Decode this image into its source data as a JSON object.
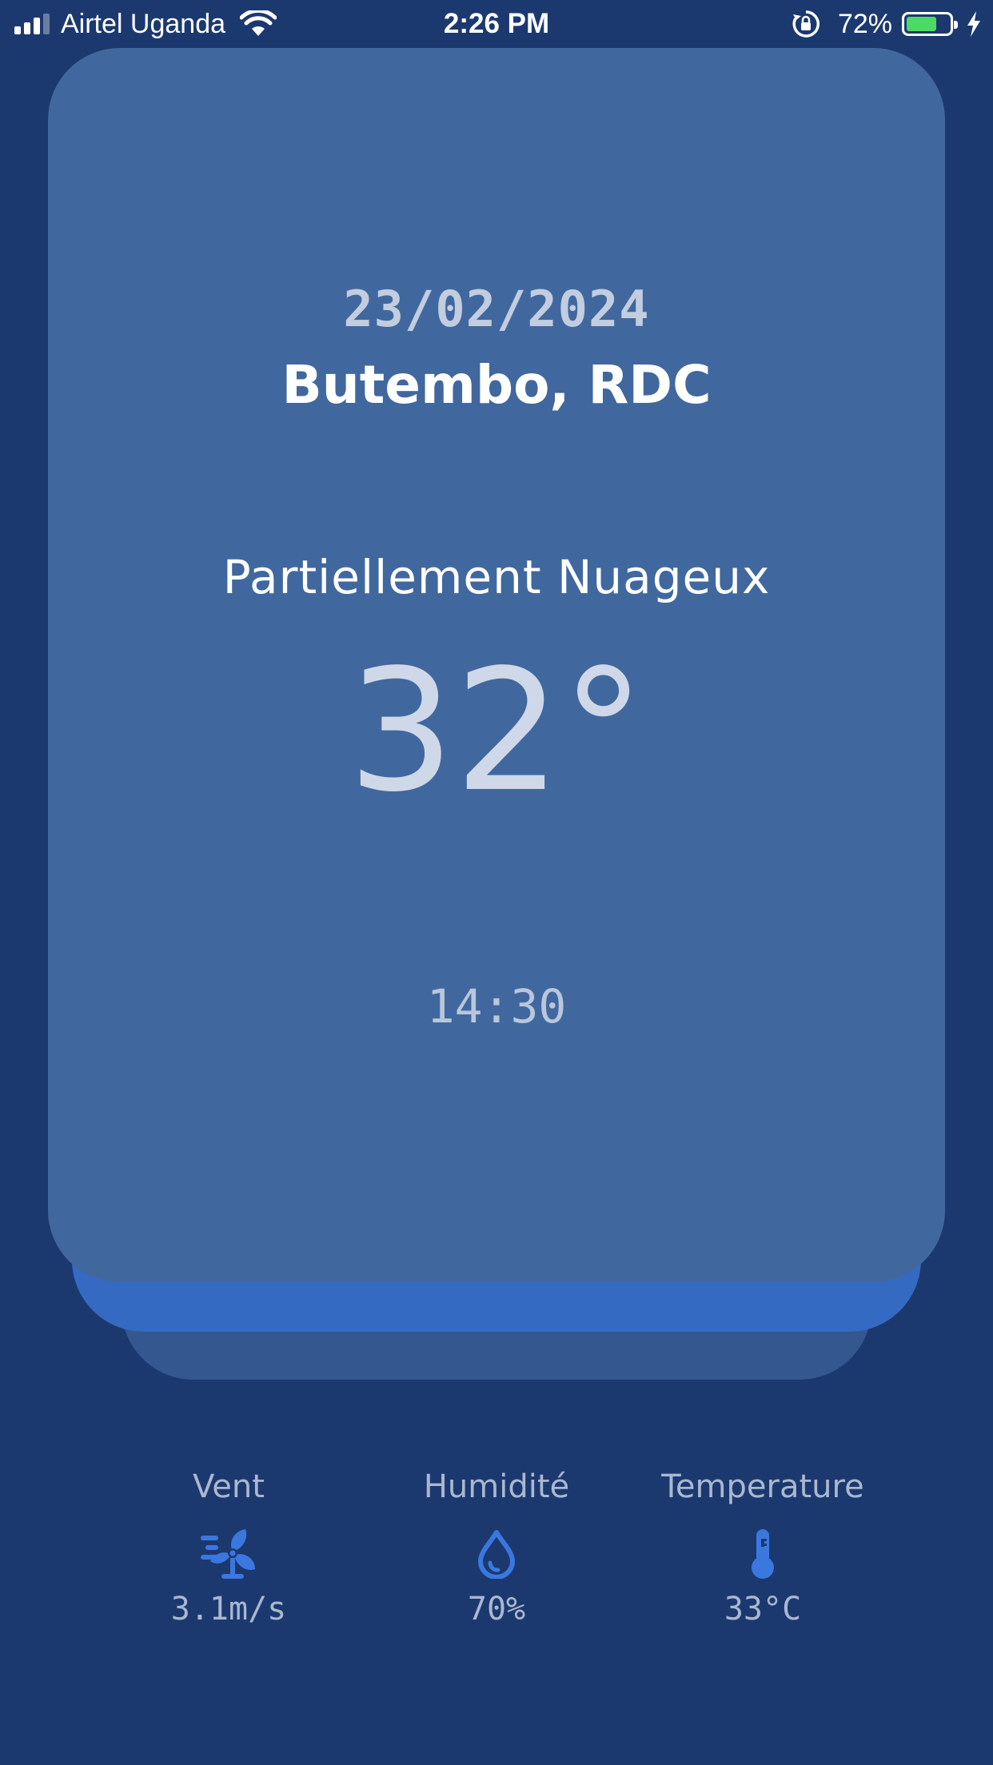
{
  "status_bar": {
    "carrier": "Airtel Uganda",
    "time": "2:26 PM",
    "battery_percent": "72%",
    "battery_level": 0.72,
    "icons": [
      "signal-icon",
      "wifi-icon",
      "rotation-lock-icon",
      "battery-icon",
      "charging-bolt-icon"
    ]
  },
  "weather": {
    "date": "23/02/2024",
    "location": "Butembo, RDC",
    "condition": "Partiellement Nuageux",
    "temperature": "32°",
    "time": "14:30"
  },
  "stats": {
    "wind": {
      "label": "Vent",
      "value": "3.1m/s",
      "icon": "wind-fan-icon"
    },
    "humidity": {
      "label": "Humidité",
      "value": "70%",
      "icon": "water-drop-icon"
    },
    "temperature": {
      "label": "Temperature",
      "value": "33°C",
      "icon": "thermometer-icon"
    }
  },
  "colors": {
    "background": "#1c396f",
    "card": "#41689e",
    "card_accent": "#356ac3",
    "icon_accent": "#3a78e0",
    "battery": "#4cd964"
  }
}
